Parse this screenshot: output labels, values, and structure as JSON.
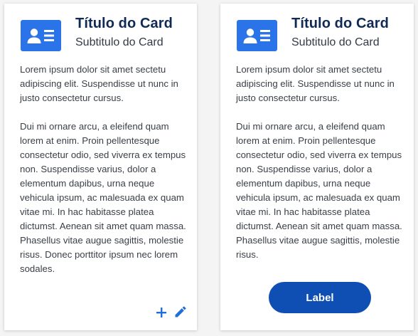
{
  "colors": {
    "accent": "#2a73e8",
    "title": "#102a57",
    "button": "#0f4fb3",
    "icon_action": "#1f6fd8"
  },
  "cards": [
    {
      "icon": "contact-card-icon",
      "title": "Título do Card",
      "subtitle": "Subtitulo do Card",
      "paragraph1": "Lorem ipsum dolor sit amet sectetu adipiscing elit. Suspendisse ut nunc in justo consectetur cursus.",
      "paragraph2": "Dui mi ornare arcu, a eleifend quam lorem at enim. Proin pellentesque consectetur odio, sed viverra ex tempus non. Suspendisse varius, dolor a elementum dapibus, urna neque vehicula ipsum, ac malesuada ex quam vitae mi. In hac habitasse platea dictumst. Aenean sit amet quam massa. Phasellus vitae augue sagittis, molestie risus. Donec porttitor ipsum nec lorem sodales.",
      "actions": [
        "plus-icon",
        "pencil-icon"
      ]
    },
    {
      "icon": "contact-card-icon",
      "title": "Título do Card",
      "subtitle": "Subtitulo do Card",
      "paragraph1": "Lorem ipsum dolor sit amet sectetu adipiscing elit. Suspendisse ut nunc in justo consectetur cursus.",
      "paragraph2": "Dui mi ornare arcu, a eleifend quam lorem at enim. Proin pellentesque consectetur odio, sed viverra ex tempus non. Suspendisse varius, dolor a elementum dapibus, urna neque vehicula ipsum, ac malesuada ex quam vitae mi. In hac habitasse platea dictumst. Aenean sit amet quam massa. Phasellus vitae augue sagittis, molestie risus.",
      "button_label": "Label"
    }
  ]
}
